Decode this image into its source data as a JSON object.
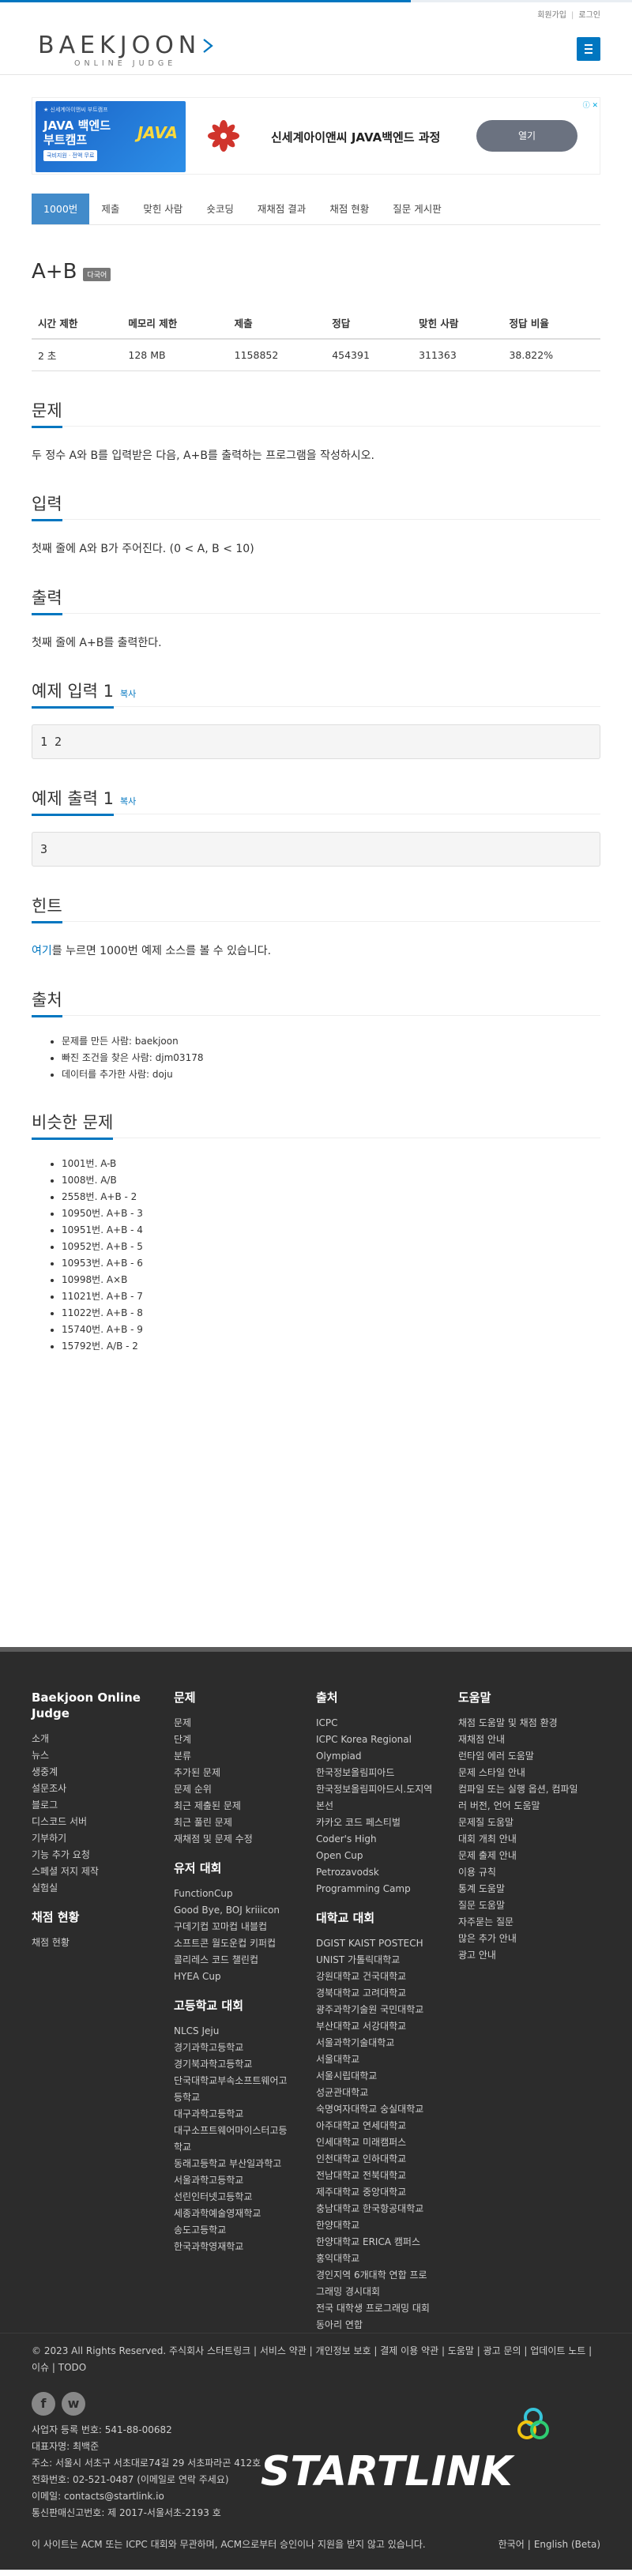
{
  "top_links": {
    "signup": "회원가입",
    "sep": "|",
    "login": "로그인"
  },
  "logo": {
    "main": "BAEKJOON",
    "sub": "ONLINE JUDGE"
  },
  "ad": {
    "mark": "ⓘ ✕",
    "banner_small": "★ 신세계아이앤씨 부트캠프",
    "banner_title": "JAVA 백엔드\n부트캠프",
    "banner_tag": "국비지원 · 전액 무료",
    "banner_word": "JAVA",
    "text": "신세계아이앤씨 JAVA백엔드 과정",
    "button": "열기"
  },
  "tabs": [
    "1000번",
    "제출",
    "맞힌 사람",
    "숏코딩",
    "재채점 결과",
    "채점 현황",
    "질문 게시판"
  ],
  "problem": {
    "title": "A+B",
    "lang_label": "다국어",
    "table_headers": [
      "시간 제한",
      "메모리 제한",
      "제출",
      "정답",
      "맞힌 사람",
      "정답 비율"
    ],
    "table_values": [
      "2 초",
      "128 MB",
      "1158852",
      "454391",
      "311363",
      "38.822%"
    ]
  },
  "sections": {
    "description_title": "문제",
    "description": "두 정수 A와 B를 입력받은 다음, A+B를 출력하는 프로그램을 작성하시오.",
    "input_title": "입력",
    "input": "첫째 줄에 A와 B가 주어진다. (0 < A, B < 10)",
    "output_title": "출력",
    "output": "첫째 줄에 A+B를 출력한다.",
    "sample_input_title": "예제 입력 1",
    "sample_input": "1 2",
    "sample_output_title": "예제 출력 1",
    "sample_output": "3",
    "copy": "복사",
    "hint_title": "힌트",
    "hint_link": "여기",
    "hint_rest": "를 누르면 1000번 예제 소스를 볼 수 있습니다.",
    "source_title": "출처",
    "source_items": [
      "문제를 만든 사람: baekjoon",
      "빠진 조건을 찾은 사람: djm03178",
      "데이터를 추가한 사람: doju"
    ],
    "similar_title": "비슷한 문제",
    "similar_items": [
      "1001번. A-B",
      "1008번. A/B",
      "2558번. A+B - 2",
      "10950번. A+B - 3",
      "10951번. A+B - 4",
      "10952번. A+B - 5",
      "10953번. A+B - 6",
      "10998번. A×B",
      "11021번. A+B - 7",
      "11022번. A+B - 8",
      "15740번. A+B - 9",
      "15792번. A/B - 2"
    ]
  },
  "footer": {
    "col1_title": "Baekjoon Online Judge",
    "col1_items": [
      "소개",
      "뉴스",
      "생중계",
      "설문조사",
      "블로그",
      "디스코드 서버",
      "기부하기",
      "기능 추가 요청",
      "스페셜 저지 제작",
      "실험실"
    ],
    "col1b_title": "채점 현황",
    "col1b_items": [
      "채점 현황"
    ],
    "col2_title": "문제",
    "col2_items": [
      "문제",
      "단계",
      "분류",
      "추가된 문제",
      "문제 순위",
      "최근 제출된 문제",
      "최근 풀린 문제",
      "재채점 및 문제 수정"
    ],
    "col2b_title": "유저 대회",
    "col2b_items": [
      "FunctionCup",
      "Good Bye, BOJ kriiicon",
      "구데기컵 꼬마컵 내블컵",
      "소프트콘 월도운컵 키퍼컵",
      "콜리레스 코드 챌린컵",
      "HYEA Cup"
    ],
    "col2c_title": "고등학교 대회",
    "col2c_items": [
      "NLCS Jeju",
      "경기과학고등학교",
      "경기북과학고등학교",
      "단국대학교부속소프트웨어고",
      "등학교",
      "대구과학고등학교",
      "대구소프트웨어마이스터고등",
      "학교",
      "동래고등학교 부산일과학고",
      "서울과학고등학교",
      "선린인터넷고등학교",
      "세종과학예술영재학교",
      "송도고등학교",
      "한국과학영재학교"
    ],
    "col3_title": "출처",
    "col3_items": [
      "ICPC",
      "ICPC Korea Regional",
      "Olympiad",
      "한국정보올림피아드",
      "한국정보올림피아드시.도지역",
      "본선",
      "카카오 코드 페스티벌",
      "Coder's High",
      "Open Cup",
      "Petrozavodsk",
      "Programming Camp"
    ],
    "col3b_title": "대학교 대회",
    "col3b_items": [
      "DGIST KAIST POSTECH",
      "UNIST 가톨릭대학교",
      "강원대학교 건국대학교",
      "경북대학교 고려대학교",
      "광주과학기술원 국민대학교",
      "부산대학교 서강대학교",
      "서울과학기술대학교",
      "서울대학교",
      "서울시립대학교",
      "성균관대학교",
      "숙명여자대학교 숭실대학교",
      "아주대학교 연세대학교",
      "인세대학교 미래캠퍼스",
      "인천대학교 인하대학교",
      "전남대학교 전북대학교",
      "제주대학교 중앙대학교",
      "충남대학교 한국항공대학교",
      "한양대학교",
      "한양대학교 ERICA 캠퍼스",
      "홍익대학교",
      "경인지역 6개대학 연합 프로",
      "그래밍 경시대회",
      "전국 대학생 프로그래밍 대회",
      "동아리 연합"
    ],
    "col4_title": "도움말",
    "col4_items": [
      "채점 도움말 및 채점 환경",
      "재채점 안내",
      "런타임 에러 도움말",
      "문제 스타일 안내",
      "컴파일 또는 실행 옵션, 컴파일",
      "러 버전, 언어 도움말",
      "문제질 도움말",
      "대회 개최 안내",
      "문제 출제 안내",
      "이용 규칙",
      "통계 도움말",
      "질문 도움말",
      "자주묻는 질문",
      "많은 추가 안내",
      "광고 안내"
    ],
    "legal": "© 2023 All Rights Reserved. 주식회사 스타트링크 | 서비스 약관 | 개인정보 보호 | 결제 이용 약관 | 도움말 | 광고 문의 | 업데이트 노트 | 이슈 | TODO",
    "social": [
      "f",
      "w"
    ],
    "company_lines": [
      "사업자 등록 번호: 541-88-00682",
      "대표자명: 최백준",
      "주소: 서울시 서초구 서초대로74길 29 서초파라곤 412호",
      "전화번호: 02-521-0487 (이메일로 연락 주세요)",
      "이메일: contacts@startlink.io",
      "통신판매신고번호: 제 2017-서울서초-2193 호"
    ],
    "brand": "STARTLINK",
    "disclaimer": "이 사이트는 ACM 또는 ICPC 대회와 무관하며, ACM으로부터 승인이나 지원을 받지 않고 있습니다.",
    "lang_ko": "한국어",
    "lang_sep": "|",
    "lang_en": "English (Beta)"
  },
  "colors": {
    "accent": "#0076c0",
    "tab_active": "#428bca",
    "footer_bg": "#2c2c2c"
  },
  "progress": {
    "top_line_fill": 0.65
  }
}
